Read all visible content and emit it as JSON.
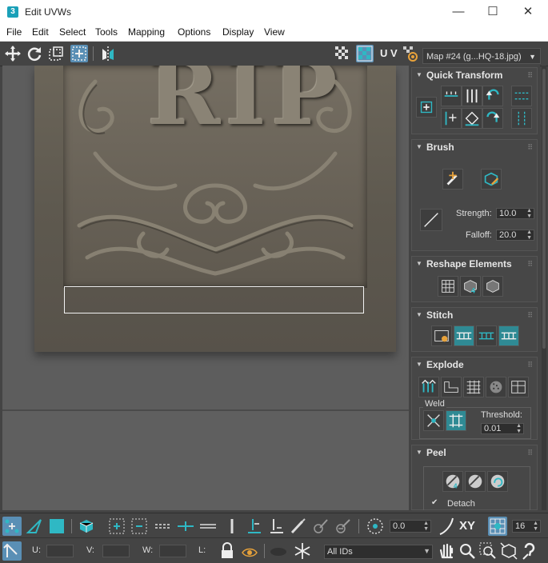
{
  "window": {
    "title": "Edit UVWs",
    "icon_label": "3",
    "min": "—",
    "max": "☐",
    "close": "✕"
  },
  "menu": [
    "File",
    "Edit",
    "Select",
    "Tools",
    "Mapping",
    "Options",
    "Display",
    "View"
  ],
  "toolbar": {
    "uv_label": "U V",
    "map_select": "Map #24 (g...HQ-18.jpg)"
  },
  "viewport": {
    "texture_text": "RIP"
  },
  "panel": {
    "quick_transform": {
      "title": "Quick Transform"
    },
    "brush": {
      "title": "Brush",
      "strength_label": "Strength:",
      "strength_value": "10.0",
      "falloff_label": "Falloff:",
      "falloff_value": "20.0"
    },
    "reshape": {
      "title": "Reshape Elements"
    },
    "stitch": {
      "title": "Stitch"
    },
    "explode": {
      "title": "Explode",
      "weld_label": "Weld",
      "threshold_label": "Threshold:",
      "threshold_value": "0.01"
    },
    "peel": {
      "title": "Peel",
      "detach_label": "Detach",
      "detach_checked": true
    }
  },
  "bottom": {
    "rotation_value": "0.0",
    "xy_label": "XY",
    "grid_value": "16",
    "u_label": "U:",
    "v_label": "V:",
    "w_label": "W:",
    "l_label": "L:",
    "ids_select": "All IDs"
  },
  "colors": {
    "accent": "#2fb8c4",
    "active_button": "#5a8fb5",
    "panel_bg": "#444444"
  }
}
